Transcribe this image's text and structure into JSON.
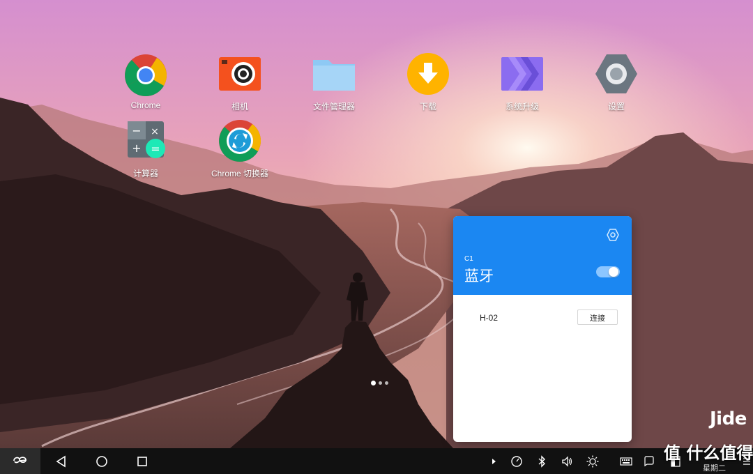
{
  "desktop": {
    "icons": [
      {
        "name": "chrome-app",
        "label": "Chrome"
      },
      {
        "name": "camera-app",
        "label": "相机"
      },
      {
        "name": "file-manager-app",
        "label": "文件管理器"
      },
      {
        "name": "download-app",
        "label": "下载"
      },
      {
        "name": "system-upgrade-app",
        "label": "系统升级"
      },
      {
        "name": "settings-app",
        "label": "设置"
      },
      {
        "name": "calculator-app",
        "label": "计算器"
      },
      {
        "name": "chrome-switcher-app",
        "label": "Chrome 切换器"
      }
    ],
    "page_indicator": {
      "pages": 3,
      "active": 1
    }
  },
  "bluetooth_panel": {
    "code": "C1",
    "title": "蓝牙",
    "enabled": true,
    "devices": [
      {
        "name": "H-02",
        "action_label": "连接"
      }
    ],
    "accent_color": "#1b87f2"
  },
  "watermark": {
    "brand": "Jide",
    "site": "值 什么值得买"
  },
  "taskbar": {
    "start_icon": "remix-logo-icon",
    "nav": [
      "back-icon",
      "home-icon",
      "recents-icon"
    ],
    "tray": [
      "expand-arrow-icon",
      "speed-icon",
      "bluetooth-icon",
      "volume-icon",
      "brightness-icon",
      "keyboard-icon",
      "notification-icon",
      "notes-icon",
      "menu-icon"
    ],
    "day": "星期二"
  }
}
